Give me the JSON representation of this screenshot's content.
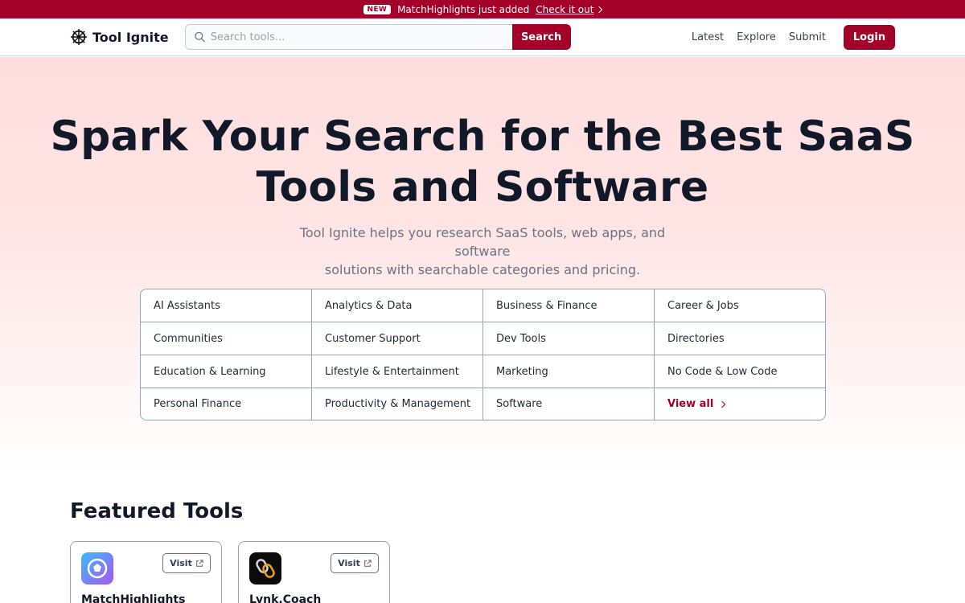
{
  "announcement": {
    "badge": "NEW",
    "text": "MatchHighlights just added",
    "link": "Check it out"
  },
  "nav": {
    "brand": "Tool Ignite",
    "search_placeholder": "Search tools...",
    "search_button": "Search",
    "links": [
      "Latest",
      "Explore",
      "Submit"
    ],
    "login": "Login"
  },
  "hero": {
    "title_line1": "Spark Your Search for the Best SaaS",
    "title_line2": "Tools and Software",
    "subtitle_line1": "Tool Ignite helps you research SaaS tools, web apps, and software",
    "subtitle_line2": "solutions with searchable categories and pricing."
  },
  "categories": [
    "AI Assistants",
    "Analytics & Data",
    "Business & Finance",
    "Career & Jobs",
    "Communities",
    "Customer Support",
    "Dev Tools",
    "Directories",
    "Education & Learning",
    "Lifestyle & Entertainment",
    "Marketing",
    "No Code & Low Code",
    "Personal Finance",
    "Productivity & Management",
    "Software"
  ],
  "view_all": "View all",
  "featured": {
    "title": "Featured Tools",
    "visit_label": "Visit",
    "tools": [
      {
        "name": "MatchHighlights"
      },
      {
        "name": "Lynk.Coach"
      }
    ]
  },
  "colors": {
    "brand": "#a3002a",
    "text": "#111827",
    "muted": "#6b7280"
  }
}
